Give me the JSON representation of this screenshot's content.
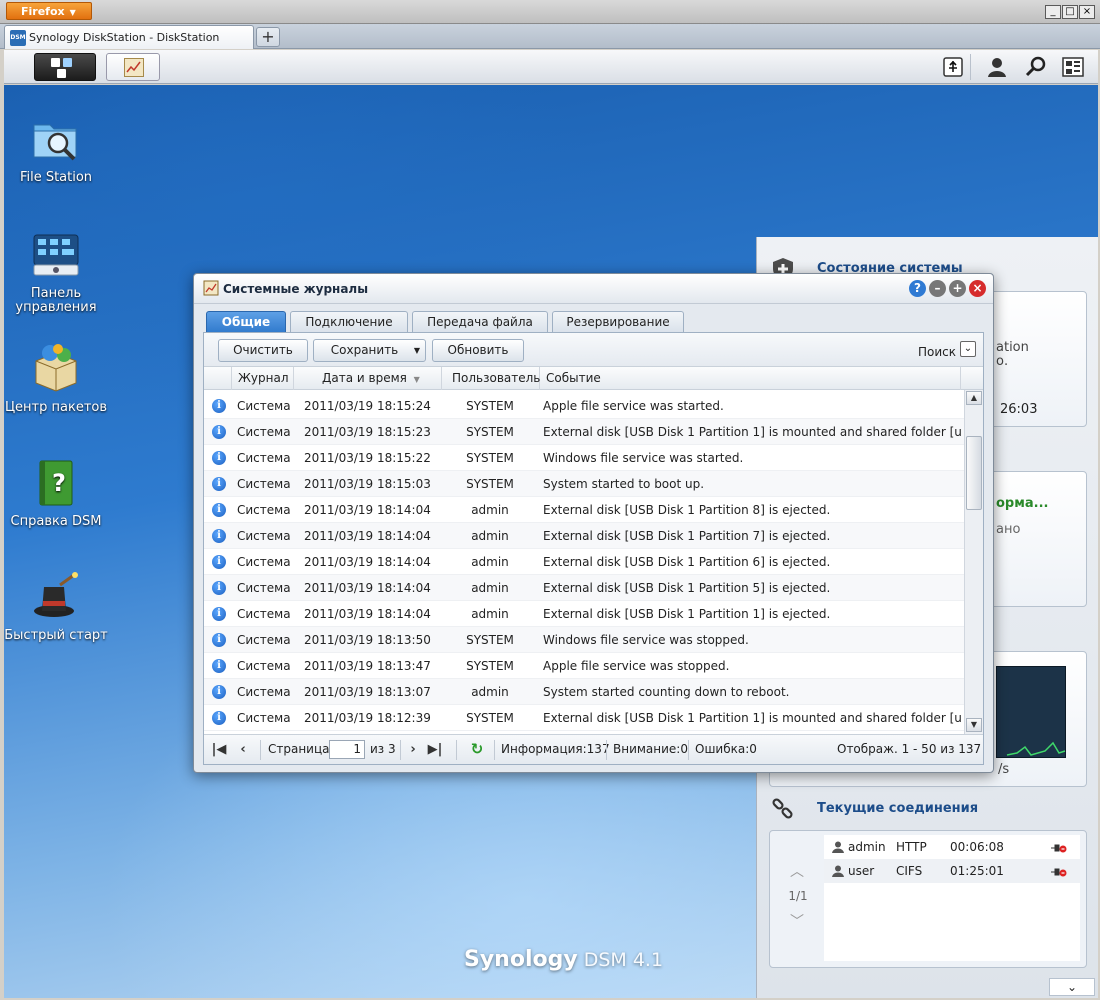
{
  "browser": {
    "menu_label": "Firefox",
    "tab_title": "Synology DiskStation - DiskStation",
    "tab_icon_text": "DSM",
    "new_tab_label": "+",
    "window_controls": [
      "_",
      "□",
      "×"
    ]
  },
  "desktop": {
    "icons": [
      {
        "name": "file-station",
        "label": "File Station"
      },
      {
        "name": "control-panel",
        "label": "Панель управления"
      },
      {
        "name": "package-center",
        "label": "Центр пакетов"
      },
      {
        "name": "dsm-help",
        "label": "Справка DSM"
      },
      {
        "name": "quick-start",
        "label": "Быстрый старт"
      }
    ],
    "brand": {
      "name": "Synology",
      "product": "DSM 4.1"
    }
  },
  "widgets": {
    "system_status": {
      "title": "Состояние системы",
      "fragment_1": "ation",
      "fragment_2": "о.",
      "time_fragment": "26:03"
    },
    "second_card": {
      "title_fragment": "орма...",
      "text_fragment": "ано"
    },
    "third_card": {
      "text_fragment": "/s"
    },
    "connections": {
      "title": "Текущие соединения",
      "pager": "1/1",
      "rows": [
        {
          "user": "admin",
          "protocol": "HTTP",
          "time": "00:06:08"
        },
        {
          "user": "user",
          "protocol": "CIFS",
          "time": "01:25:01"
        }
      ]
    },
    "collapse_label": "⌄"
  },
  "log_window": {
    "title": "Системные журналы",
    "tabs": [
      "Общие",
      "Подключение",
      "Передача файла",
      "Резервирование"
    ],
    "active_tab": 0,
    "toolbar": {
      "clear": "Очистить",
      "save": "Сохранить",
      "refresh": "Обновить",
      "search": "Поиск"
    },
    "columns": {
      "log": "Журнал",
      "datetime": "Дата и время",
      "user": "Пользователь",
      "event": "Событие"
    },
    "rows": [
      {
        "log": "Система",
        "datetime": "2011/03/19 18:15:24",
        "user": "SYSTEM",
        "event": "Apple file service was started."
      },
      {
        "log": "Система",
        "datetime": "2011/03/19 18:15:23",
        "user": "SYSTEM",
        "event": "External disk [USB Disk 1 Partition 1] is mounted and shared folder [u..."
      },
      {
        "log": "Система",
        "datetime": "2011/03/19 18:15:22",
        "user": "SYSTEM",
        "event": "Windows file service was started."
      },
      {
        "log": "Система",
        "datetime": "2011/03/19 18:15:03",
        "user": "SYSTEM",
        "event": "System started to boot up."
      },
      {
        "log": "Система",
        "datetime": "2011/03/19 18:14:04",
        "user": "admin",
        "event": "External disk [USB Disk 1 Partition 8] is ejected."
      },
      {
        "log": "Система",
        "datetime": "2011/03/19 18:14:04",
        "user": "admin",
        "event": "External disk [USB Disk 1 Partition 7] is ejected."
      },
      {
        "log": "Система",
        "datetime": "2011/03/19 18:14:04",
        "user": "admin",
        "event": "External disk [USB Disk 1 Partition 6] is ejected."
      },
      {
        "log": "Система",
        "datetime": "2011/03/19 18:14:04",
        "user": "admin",
        "event": "External disk [USB Disk 1 Partition 5] is ejected."
      },
      {
        "log": "Система",
        "datetime": "2011/03/19 18:14:04",
        "user": "admin",
        "event": "External disk [USB Disk 1 Partition 1] is ejected."
      },
      {
        "log": "Система",
        "datetime": "2011/03/19 18:13:50",
        "user": "SYSTEM",
        "event": "Windows file service was stopped."
      },
      {
        "log": "Система",
        "datetime": "2011/03/19 18:13:47",
        "user": "SYSTEM",
        "event": "Apple file service was stopped."
      },
      {
        "log": "Система",
        "datetime": "2011/03/19 18:13:07",
        "user": "admin",
        "event": "System started counting down to reboot."
      },
      {
        "log": "Система",
        "datetime": "2011/03/19 18:12:39",
        "user": "SYSTEM",
        "event": "External disk [USB Disk 1 Partition 1] is mounted and shared folder [u..."
      }
    ],
    "pager": {
      "page_label": "Страница",
      "page_value": "1",
      "of_label": "из 3",
      "info": "Информация:137",
      "warning": "Внимание:0",
      "error": "Ошибка:0",
      "display": "Отображ. 1 - 50 из 137"
    }
  }
}
